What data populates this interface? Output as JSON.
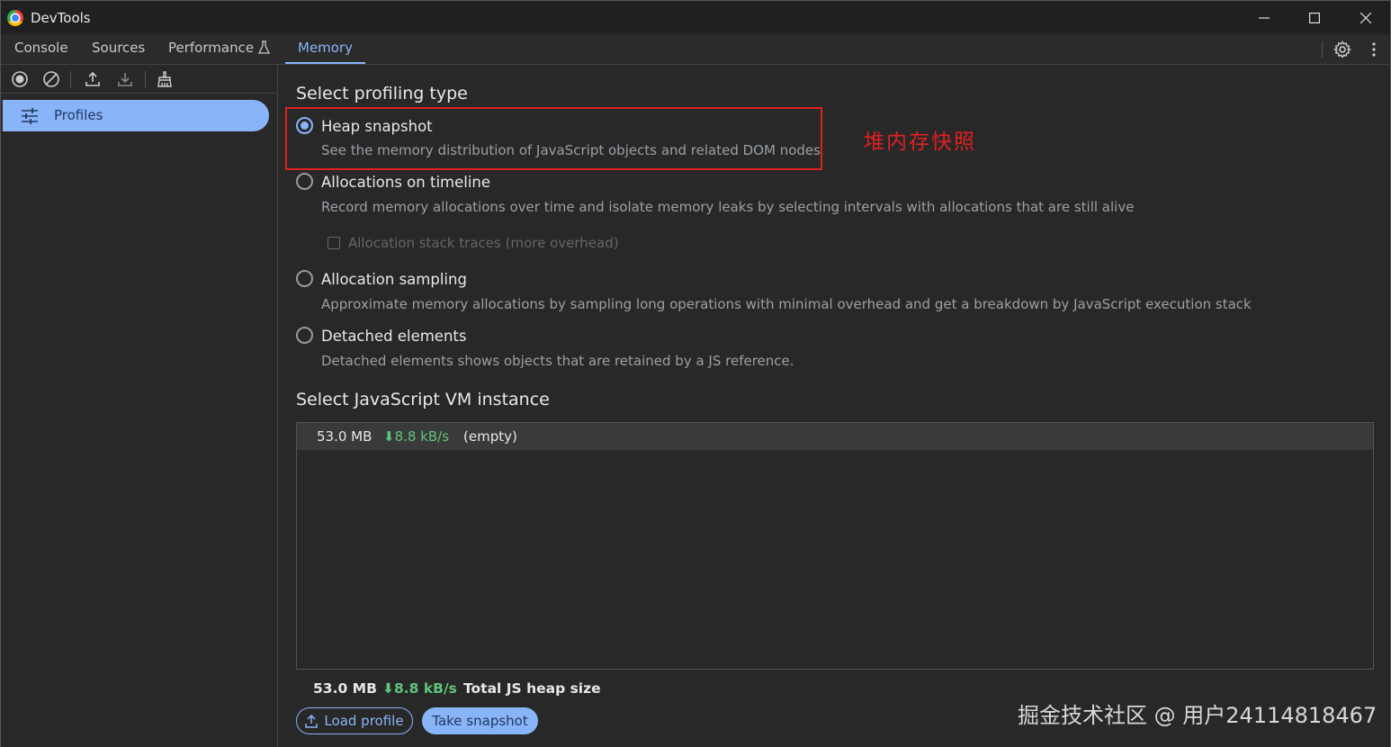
{
  "window": {
    "title": "DevTools"
  },
  "tabs": [
    {
      "label": "Console"
    },
    {
      "label": "Sources"
    },
    {
      "label": "Performance"
    },
    {
      "label": "Memory"
    }
  ],
  "sidebar": {
    "items": [
      {
        "label": "Profiles",
        "icon": "sliders-icon"
      }
    ]
  },
  "main": {
    "section_title": "Select profiling type",
    "options": [
      {
        "title": "Heap snapshot",
        "description": "See the memory distribution of JavaScript objects and related DOM nodes",
        "selected": true
      },
      {
        "title": "Allocations on timeline",
        "description": "Record memory allocations over time and isolate memory leaks by selecting intervals with allocations that are still alive",
        "selected": false
      },
      {
        "title": "Allocation sampling",
        "description": "Approximate memory allocations by sampling long operations with minimal overhead and get a breakdown by JavaScript execution stack",
        "selected": false
      },
      {
        "title": "Detached elements",
        "description": "Detached elements shows objects that are retained by a JS reference.",
        "selected": false
      }
    ],
    "allocation_stack_traces_label": "Allocation stack traces (more overhead)",
    "annotation": "堆内存快照",
    "vm_section_title": "Select JavaScript VM instance",
    "vm_instances": [
      {
        "memory": "53.0 MB",
        "rate": "⬇8.8 kB/s",
        "name": "(empty)"
      }
    ],
    "footer": {
      "memory": "53.0 MB",
      "rate": "⬇8.8 kB/s",
      "label": "Total JS heap size"
    },
    "load_button": "Load profile",
    "take_button": "Take snapshot"
  },
  "watermark": "掘金技术社区 @ 用户24114818467",
  "colors": {
    "accent": "#8ab4f8",
    "annotation_red": "#e02020",
    "rate_green": "#5fc47a"
  }
}
